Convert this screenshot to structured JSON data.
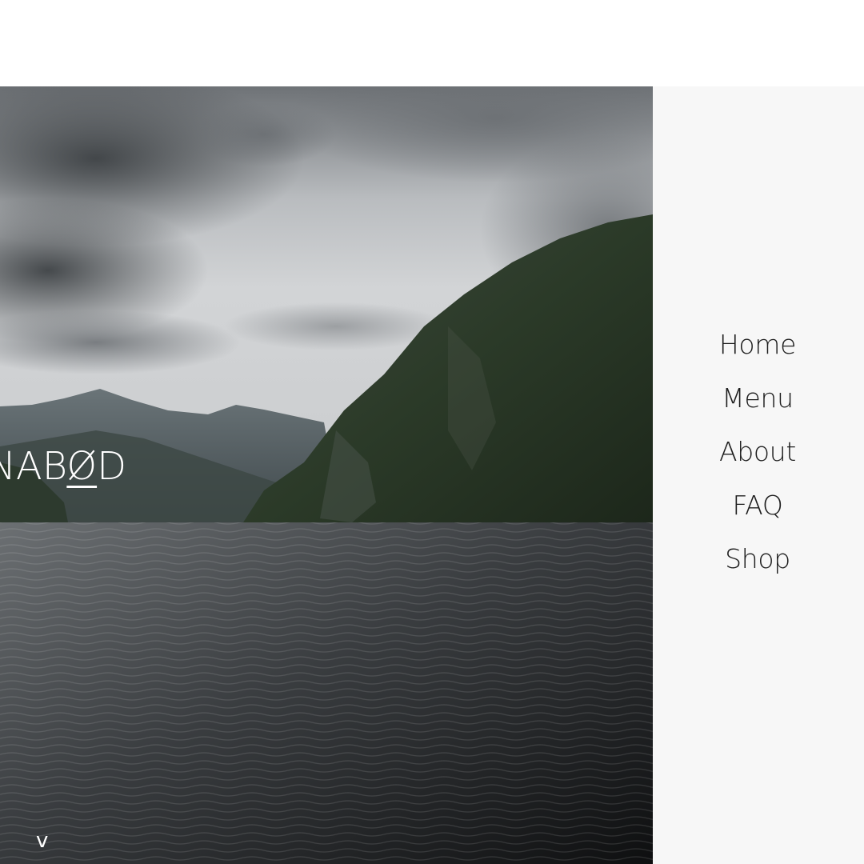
{
  "brand": {
    "prefix": "NAB",
    "highlight": "Ø",
    "suffix": "D"
  },
  "scroll_hint": "v",
  "nav": {
    "items": [
      {
        "label": "Home"
      },
      {
        "label": "Menu"
      },
      {
        "label": "About"
      },
      {
        "label": "FAQ"
      },
      {
        "label": "Shop"
      }
    ]
  },
  "colors": {
    "nav_background": "#f7f7f7",
    "nav_text": "#1e1e1e",
    "brand_text": "#ffffff"
  }
}
